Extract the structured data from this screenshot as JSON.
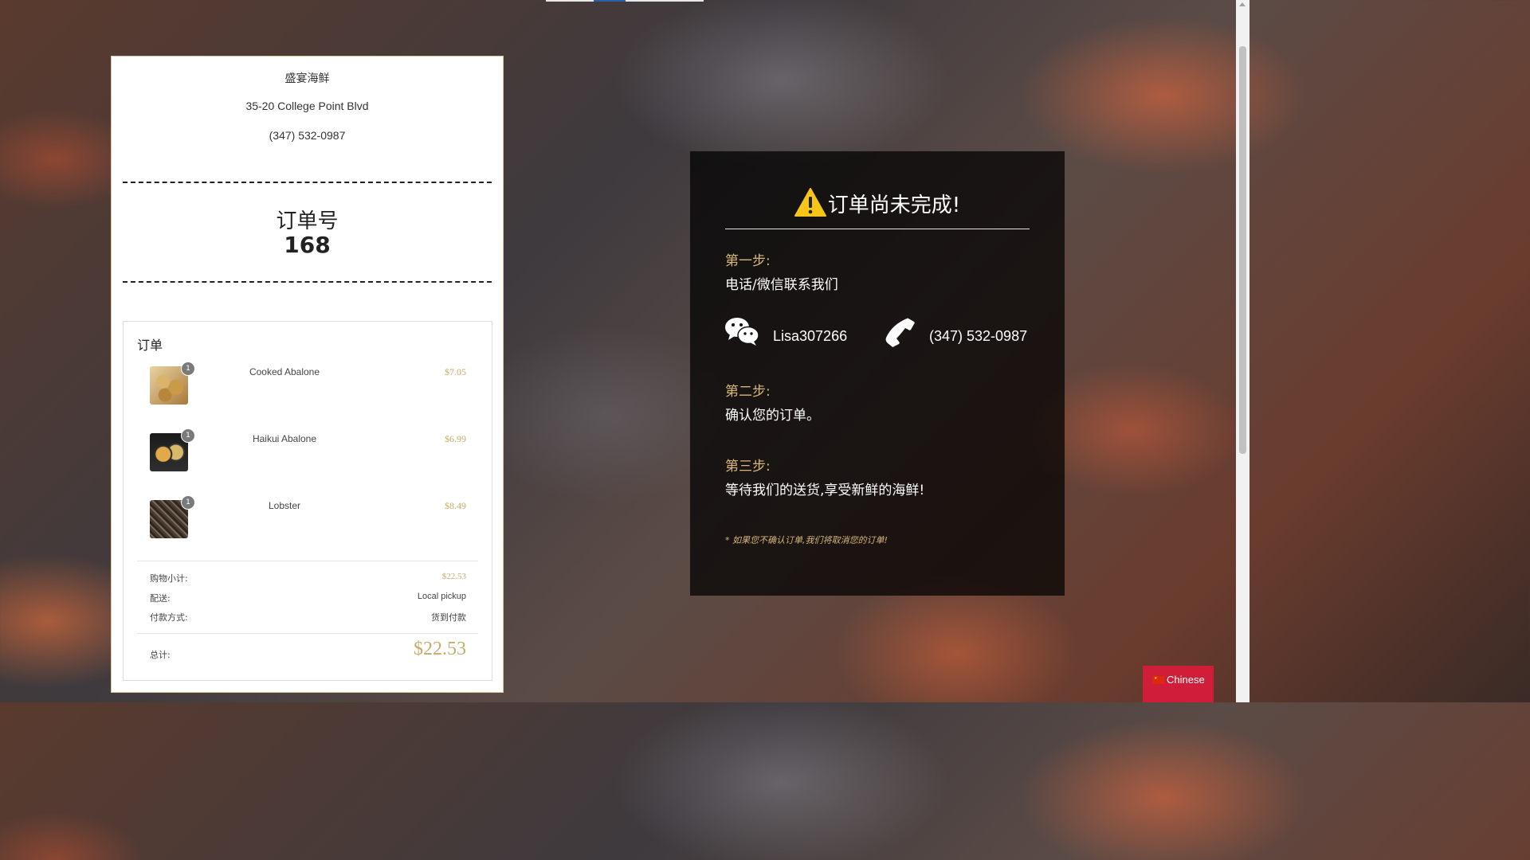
{
  "store": {
    "name": "盛宴海鲜",
    "address": "35-20 College Point Blvd",
    "phone": "(347) 532-0987"
  },
  "order": {
    "label": "订单号",
    "number": "168",
    "section_title": "订单",
    "items": [
      {
        "name": "Cooked Abalone",
        "price": "$7.05",
        "qty": "1"
      },
      {
        "name": "Haikui Abalone",
        "price": "$6.99",
        "qty": "1"
      },
      {
        "name": "Lobster",
        "price": "$8.49",
        "qty": "1"
      }
    ],
    "subtotal_label": "购物小计:",
    "subtotal_value": "$22.53",
    "shipping_label": "配送:",
    "shipping_value": "Local pickup",
    "payment_label": "付款方式:",
    "payment_value": "货到付款",
    "total_label": "总计:",
    "total_value": "$22.53"
  },
  "panel": {
    "headline": "订单尚未完成!",
    "step1_label": "第一步:",
    "step1_text": "电话/微信联系我们",
    "wechat_id": "Lisa307266",
    "phone": "(347) 532-0987",
    "step2_label": "第二步:",
    "step2_text": "确认您的订单。",
    "step3_label": "第三步:",
    "step3_text": "等待我们的送货,享受新鲜的海鲜!",
    "note": "* 如果您不确认订单,我们将取消您的订单!"
  },
  "language_button": {
    "label": "Chinese",
    "flag_icon": "china-flag-icon"
  },
  "colors": {
    "accent_gold": "#c9ab6a",
    "step_gold": "#d8b778",
    "language_red": "#d01e3a"
  }
}
